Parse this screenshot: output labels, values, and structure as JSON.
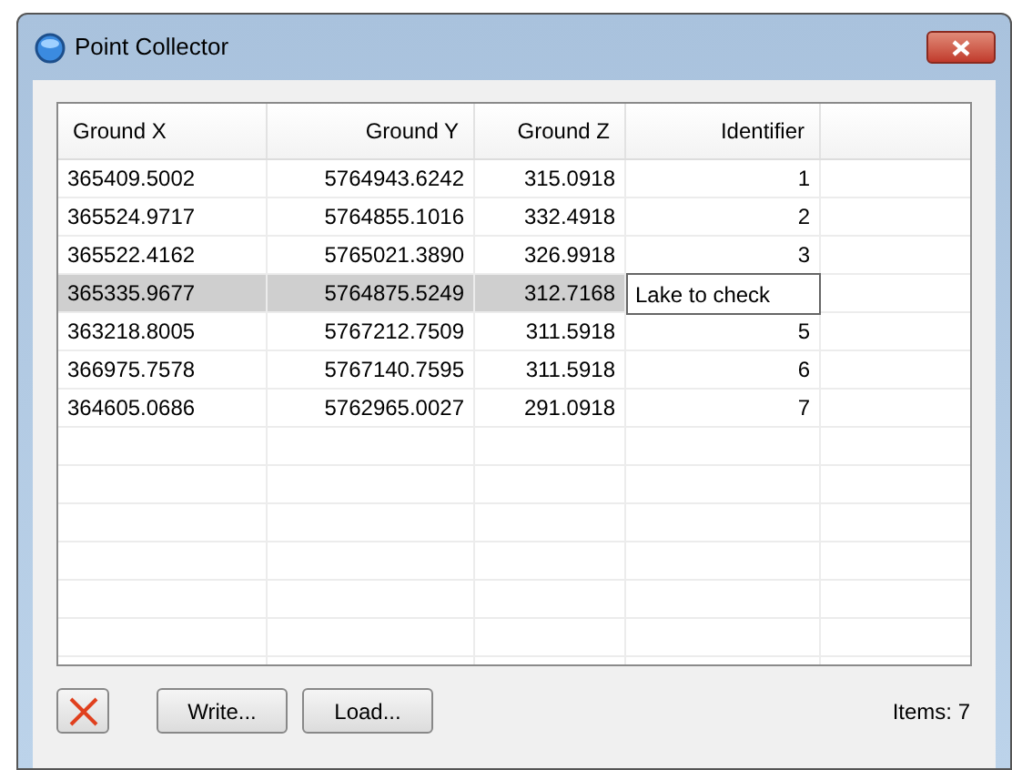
{
  "window": {
    "title": "Point Collector"
  },
  "table": {
    "columns": [
      "Ground X",
      "Ground Y",
      "Ground Z",
      "Identifier"
    ],
    "rows": [
      {
        "cells": [
          "365409.5002",
          "5764943.6242",
          "315.0918",
          "1"
        ],
        "selected": false,
        "editing": false
      },
      {
        "cells": [
          "365524.9717",
          "5764855.1016",
          "332.4918",
          "2"
        ],
        "selected": false,
        "editing": false
      },
      {
        "cells": [
          "365522.4162",
          "5765021.3890",
          "326.9918",
          "3"
        ],
        "selected": false,
        "editing": false
      },
      {
        "cells": [
          "365335.9677",
          "5764875.5249",
          "312.7168",
          "Lake to check"
        ],
        "selected": true,
        "editing": true
      },
      {
        "cells": [
          "363218.8005",
          "5767212.7509",
          "311.5918",
          "5"
        ],
        "selected": false,
        "editing": false
      },
      {
        "cells": [
          "366975.7578",
          "5767140.7595",
          "311.5918",
          "6"
        ],
        "selected": false,
        "editing": false
      },
      {
        "cells": [
          "364605.0686",
          "5762965.0027",
          "291.0918",
          "7"
        ],
        "selected": false,
        "editing": false
      }
    ]
  },
  "buttons": [
    "Write...",
    "Load..."
  ],
  "status": "Items: 7"
}
